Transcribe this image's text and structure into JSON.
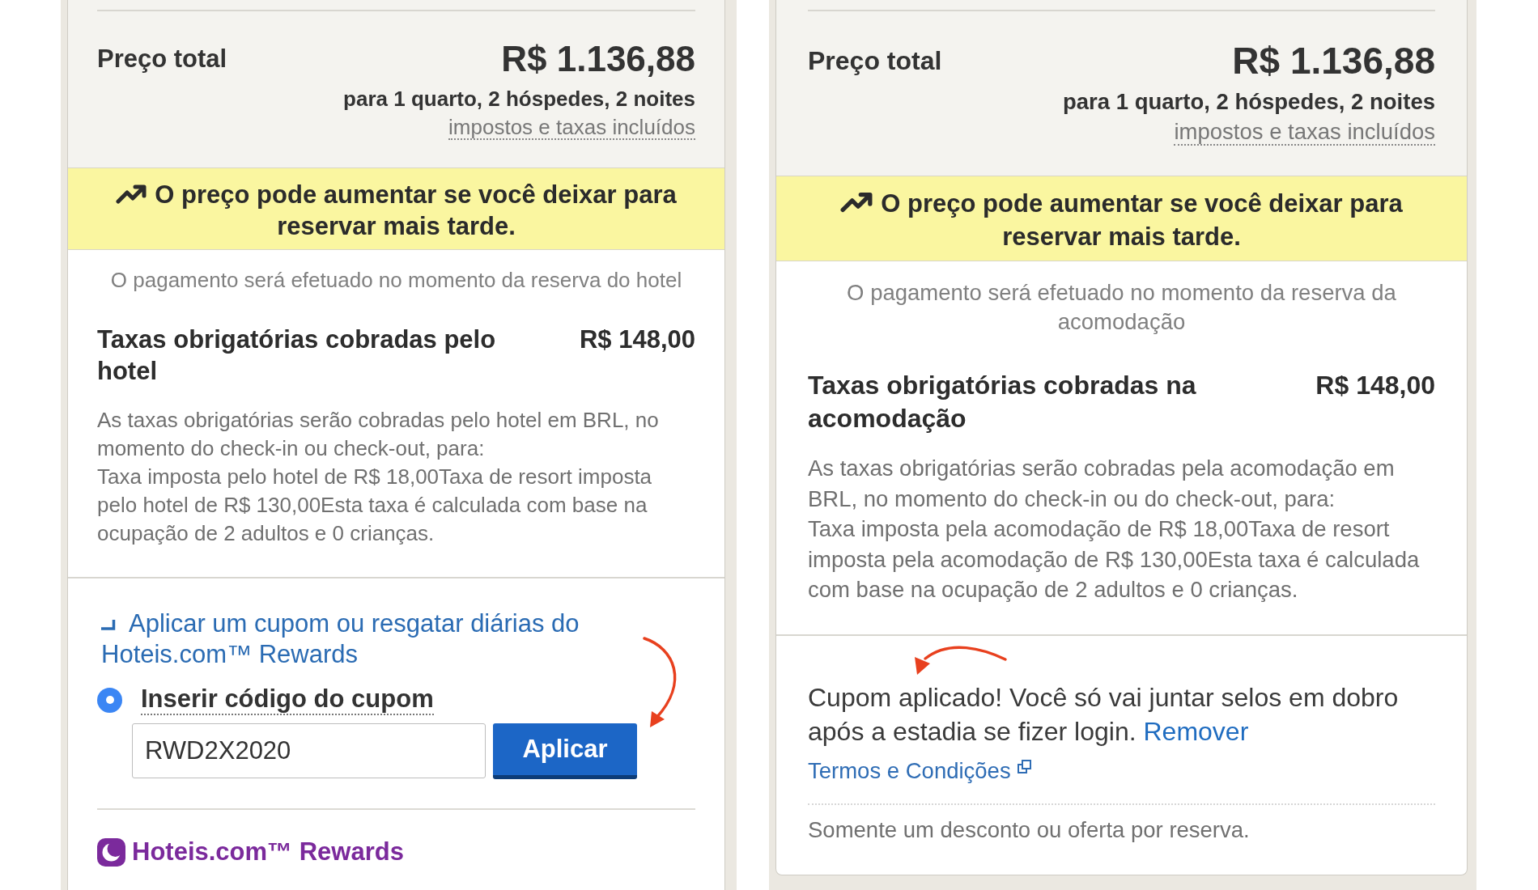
{
  "panels": [
    {
      "kind": "coupon_form",
      "price_summary": {
        "label": "Preço total",
        "amount": "R$ 1.136,88",
        "details": "para 1 quarto, 2 hóspedes, 2 noites",
        "taxes_note": "impostos e taxas incluídos"
      },
      "price_alert": "O preço pode aumentar se você deixar para reservar mais tarde.",
      "payment_note": "O pagamento será efetuado no momento da reserva do hotel",
      "mandatory_fees": {
        "title": "Taxas obrigatórias cobradas pelo hotel",
        "amount": "R$ 148,00",
        "description": [
          "As taxas obrigatórias serão cobradas pelo hotel em BRL, no momento do check-in ou check-out, para:",
          "Taxa imposta pelo hotel de R$ 18,00Taxa de resort imposta pelo hotel de R$ 130,00Esta taxa é calculada com base na ocupação de 2 adultos e 0 crianças."
        ]
      },
      "coupon": {
        "toggle_link": "Aplicar um cupom ou resgatar diárias do Hoteis.com™ Rewards",
        "expanded": true,
        "options": [
          {
            "label": "Inserir código do cupom",
            "selected": true
          }
        ],
        "code_input": {
          "value": "RWD2X2020"
        },
        "apply_button": "Aplicar"
      },
      "rewards": {
        "title": "Hoteis.com™ Rewards"
      }
    },
    {
      "kind": "coupon_applied",
      "price_summary": {
        "label": "Preço total",
        "amount": "R$ 1.136,88",
        "details": "para 1 quarto, 2 hóspedes, 2 noites",
        "taxes_note": "impostos e taxas incluídos"
      },
      "price_alert": "O preço pode aumentar se você deixar para reservar mais tarde.",
      "payment_note": "O pagamento será efetuado no momento da reserva da acomodação",
      "mandatory_fees": {
        "title": "Taxas obrigatórias cobradas na acomodação",
        "amount": "R$ 148,00",
        "description": [
          "As taxas obrigatórias serão cobradas pela acomodação em BRL, no momento do check-in ou do check-out, para:",
          "Taxa imposta pela acomodação de R$ 18,00Taxa de resort imposta pela acomodação de R$ 130,00Esta taxa é calculada com base na ocupação de 2 adultos e 0 crianças."
        ]
      },
      "coupon": {
        "message": "Cupom aplicado! Você só vai juntar selos em dobro após a estadia se fizer login.",
        "remove_link": "Remover",
        "terms_link": "Termos e Condições",
        "note": "Somente um desconto ou oferta por reserva."
      }
    }
  ]
}
